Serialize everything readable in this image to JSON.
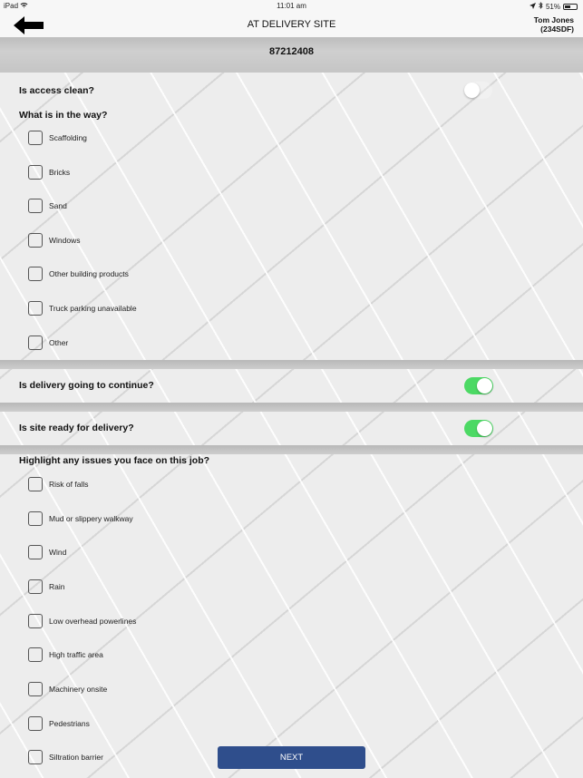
{
  "status_bar": {
    "device": "iPad",
    "wifi_icon": "wifi-icon",
    "time": "11:01 am",
    "location_icon": "location-arrow-icon",
    "bluetooth_icon": "bluetooth-icon",
    "battery_percent": "51%",
    "battery_level": 0.51
  },
  "nav": {
    "back_icon": "back-arrow-icon",
    "title": "AT DELIVERY SITE",
    "user_name": "Tom Jones",
    "user_id": "(234SDF)"
  },
  "job": {
    "number": "87212408"
  },
  "access": {
    "question": "Is access clean?",
    "toggle_on": false
  },
  "obstacles": {
    "question": "What is in the way?",
    "items": [
      {
        "label": "Scaffolding",
        "checked": false
      },
      {
        "label": "Bricks",
        "checked": false
      },
      {
        "label": "Sand",
        "checked": false
      },
      {
        "label": "Windows",
        "checked": false
      },
      {
        "label": "Other building products",
        "checked": false
      },
      {
        "label": "Truck parking unavailable",
        "checked": false
      },
      {
        "label": "Other",
        "checked": false
      }
    ]
  },
  "continue_delivery": {
    "question": "Is delivery going to continue?",
    "toggle_on": true
  },
  "site_ready": {
    "question": "Is site ready for delivery?",
    "toggle_on": true
  },
  "issues": {
    "question": "Highlight any issues you face on this job?",
    "items": [
      {
        "label": "Risk of falls",
        "checked": false
      },
      {
        "label": "Mud or slippery walkway",
        "checked": false
      },
      {
        "label": "Wind",
        "checked": false
      },
      {
        "label": "Rain",
        "checked": false
      },
      {
        "label": "Low overhead powerlines",
        "checked": false
      },
      {
        "label": "High traffic area",
        "checked": false
      },
      {
        "label": "Machinery onsite",
        "checked": false
      },
      {
        "label": "Pedestrians",
        "checked": false
      },
      {
        "label": "Siltration barrier",
        "checked": false
      }
    ]
  },
  "footer": {
    "next_label": "NEXT"
  },
  "colors": {
    "toggle_on": "#4cd964",
    "button_primary": "#2f4e8c"
  }
}
